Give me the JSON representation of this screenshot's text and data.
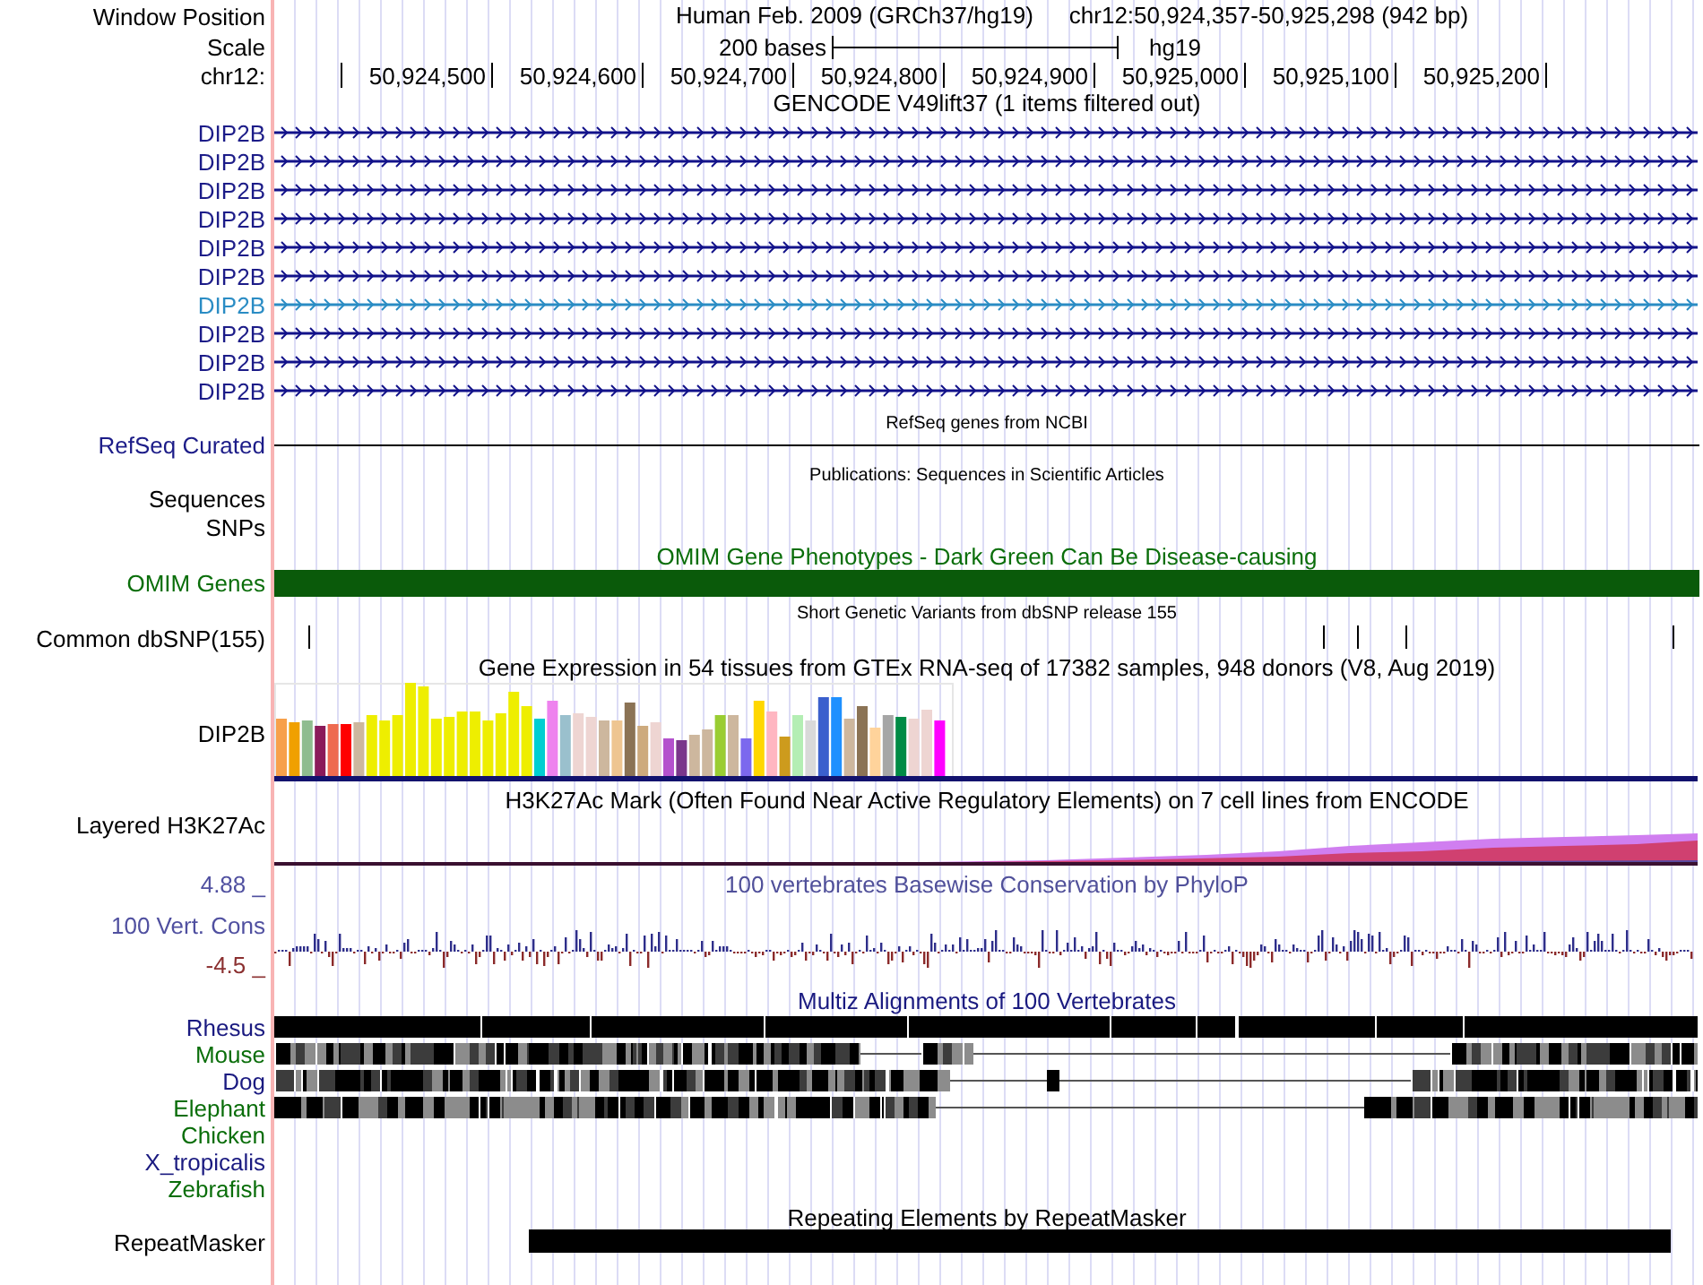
{
  "header": {
    "label": "Window Position",
    "title": "Human Feb. 2009 (GRCh37/hg19)",
    "position": "chr12:50,924,357-50,925,298 (942 bp)"
  },
  "scale": {
    "label": "Scale",
    "bar_text": "200 bases",
    "assembly": "hg19"
  },
  "ruler": {
    "label": "chr12:",
    "ticks": [
      "50,924,500",
      "50,924,600",
      "50,924,700",
      "50,924,800",
      "50,924,900",
      "50,925,000",
      "50,925,100",
      "50,925,200"
    ]
  },
  "gencode": {
    "title": "GENCODE V49lift37 (1 items filtered out)",
    "items": [
      {
        "name": "DIP2B",
        "selected": false
      },
      {
        "name": "DIP2B",
        "selected": false
      },
      {
        "name": "DIP2B",
        "selected": false
      },
      {
        "name": "DIP2B",
        "selected": false
      },
      {
        "name": "DIP2B",
        "selected": false
      },
      {
        "name": "DIP2B",
        "selected": false
      },
      {
        "name": "DIP2B",
        "selected": true
      },
      {
        "name": "DIP2B",
        "selected": false
      },
      {
        "name": "DIP2B",
        "selected": false
      },
      {
        "name": "DIP2B",
        "selected": false
      }
    ]
  },
  "refseq": {
    "caption": "RefSeq genes from NCBI",
    "label": "RefSeq Curated"
  },
  "publications": {
    "caption": "Publications: Sequences in Scientific Articles",
    "labels": [
      "Sequences",
      "SNPs"
    ]
  },
  "omim": {
    "caption": "OMIM Gene Phenotypes - Dark Green Can Be Disease-causing",
    "label": "OMIM Genes"
  },
  "dbsnp": {
    "caption": "Short Genetic Variants from dbSNP release 155",
    "label": "Common dbSNP(155)"
  },
  "gtex": {
    "caption": "Gene Expression in 54 tissues from GTEx RNA-seq of 17382 samples, 948 donors (V8, Aug 2019)",
    "label": "DIP2B"
  },
  "h3k27ac": {
    "caption": "H3K27Ac Mark (Often Found Near Active Regulatory Elements) on 7 cell lines from ENCODE",
    "label": "Layered H3K27Ac"
  },
  "phylop": {
    "caption": "100 vertebrates Basewise Conservation by PhyloP",
    "label": "100 Vert. Cons",
    "max": "4.88 _",
    "min": "-4.5 _"
  },
  "multiz": {
    "caption": "Multiz Alignments of 100 Vertebrates",
    "species": [
      {
        "name": "Rhesus",
        "color": "#1a1a80"
      },
      {
        "name": "Mouse",
        "color": "#0a6e0a"
      },
      {
        "name": "Dog",
        "color": "#1a1a80"
      },
      {
        "name": "Elephant",
        "color": "#0a6e0a"
      },
      {
        "name": "Chicken",
        "color": "#0a6e0a"
      },
      {
        "name": "X_tropicalis",
        "color": "#1a1a80"
      },
      {
        "name": "Zebrafish",
        "color": "#0a6e0a"
      }
    ]
  },
  "repeatmasker": {
    "caption": "Repeating Elements by RepeatMasker",
    "label": "RepeatMasker"
  }
}
